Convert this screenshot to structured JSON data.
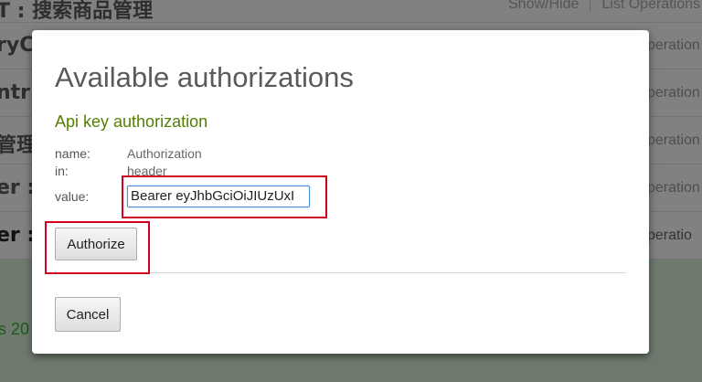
{
  "background": {
    "header_fragment": "T : 搜索商品管理",
    "header_links": [
      "Show/Hide",
      "List Operations"
    ],
    "rows": [
      {
        "left": "ryC",
        "right": "peration"
      },
      {
        "left": "ntr",
        "right": "peration"
      },
      {
        "left": "管理",
        "right": "peration"
      },
      {
        "left": "er : ",
        "right": "peration"
      },
      {
        "left": "er : ",
        "right": "peratio"
      }
    ],
    "status_fragment": "s 20"
  },
  "modal": {
    "title": "Available authorizations",
    "section_title": "Api key authorization",
    "fields": {
      "name_label": "name:",
      "name_value": "Authorization",
      "in_label": "in:",
      "in_value": "header",
      "value_label": "value:",
      "value_input": "Bearer eyJhbGciOiJIUzUxI"
    },
    "authorize_label": "Authorize",
    "cancel_label": "Cancel"
  },
  "colors": {
    "section_title": "#547f00",
    "highlight": "#d0021b",
    "input_focus": "#4a90d9"
  }
}
